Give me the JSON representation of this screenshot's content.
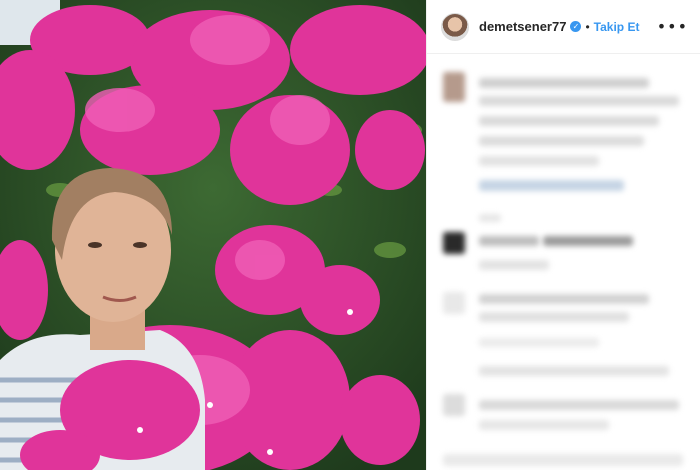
{
  "post": {
    "username": "demetsener77",
    "verified_glyph": "✓",
    "separator": "•",
    "follow_label": "Takip Et",
    "more_glyph": "•••",
    "verified_color": "#3897f0",
    "photo_description_icon": "photo"
  },
  "comments_note": ""
}
